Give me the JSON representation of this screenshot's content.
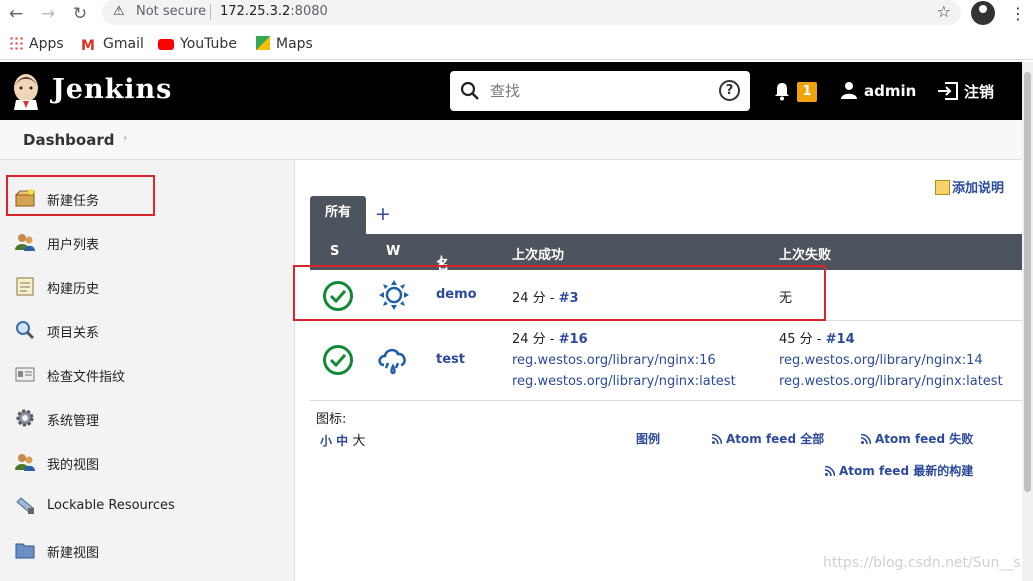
{
  "browser": {
    "security": "Not secure",
    "host": "172.25.3.2",
    "port": ":8080",
    "bookmarks": [
      "Apps",
      "Gmail",
      "YouTube",
      "Maps"
    ]
  },
  "header": {
    "logo": "Jenkins",
    "search_placeholder": "查找",
    "help": "?",
    "notifications": "1",
    "user": "admin",
    "logout": "注销"
  },
  "breadcrumb": {
    "root": "Dashboard",
    "chevron": "›"
  },
  "side": {
    "tasks": [
      {
        "label": "新建任务",
        "icon": "new-item-icon"
      },
      {
        "label": "用户列表",
        "icon": "users-icon"
      },
      {
        "label": "构建历史",
        "icon": "notepad-icon"
      },
      {
        "label": "项目关系",
        "icon": "magnifier-icon"
      },
      {
        "label": "检查文件指纹",
        "icon": "fingerprint-icon"
      },
      {
        "label": "系统管理",
        "icon": "gear-icon"
      },
      {
        "label": "我的视图",
        "icon": "user-icon"
      },
      {
        "label": "Lockable Resources",
        "icon": "lock-resource-icon"
      },
      {
        "label": "新建视图",
        "icon": "folder-icon"
      }
    ]
  },
  "main": {
    "add_description": "添加说明",
    "tab_all": "所有",
    "tab_add": "+",
    "columns": {
      "s": "S",
      "w": "W",
      "name": "名称",
      "sort": "↓",
      "last_success": "上次成功",
      "last_failure": "上次失败"
    },
    "jobs": [
      {
        "name": "demo",
        "weather": "sunny",
        "last_success": {
          "time": "24 分 - ",
          "build": "#3",
          "extra": []
        },
        "last_failure": {
          "time": "无",
          "build": "",
          "extra": []
        }
      },
      {
        "name": "test",
        "weather": "rain",
        "last_success": {
          "time": "24 分 - ",
          "build": "#16",
          "extra": [
            "reg.westos.org/library/nginx:16",
            "reg.westos.org/library/nginx:latest"
          ]
        },
        "last_failure": {
          "time": "45 分 - ",
          "build": "#14",
          "extra": [
            "reg.westos.org/library/nginx:14",
            "reg.westos.org/library/nginx:latest"
          ]
        }
      }
    ],
    "icon_size_label": "图标:",
    "icon_sizes": [
      "小",
      "中",
      "大"
    ],
    "legend": "图例",
    "feeds": [
      "Atom feed 全部",
      "Atom feed 失败",
      "Atom feed 最新的构建"
    ]
  },
  "watermark": "https://blog.csdn.net/Sun__s",
  "colors": {
    "header_bg": "#000000",
    "table_head": "#4d545d",
    "link": "#2c4a9c",
    "success": "#138a36",
    "badge": "#f0a30a",
    "annotation_red": "#d9262b"
  }
}
